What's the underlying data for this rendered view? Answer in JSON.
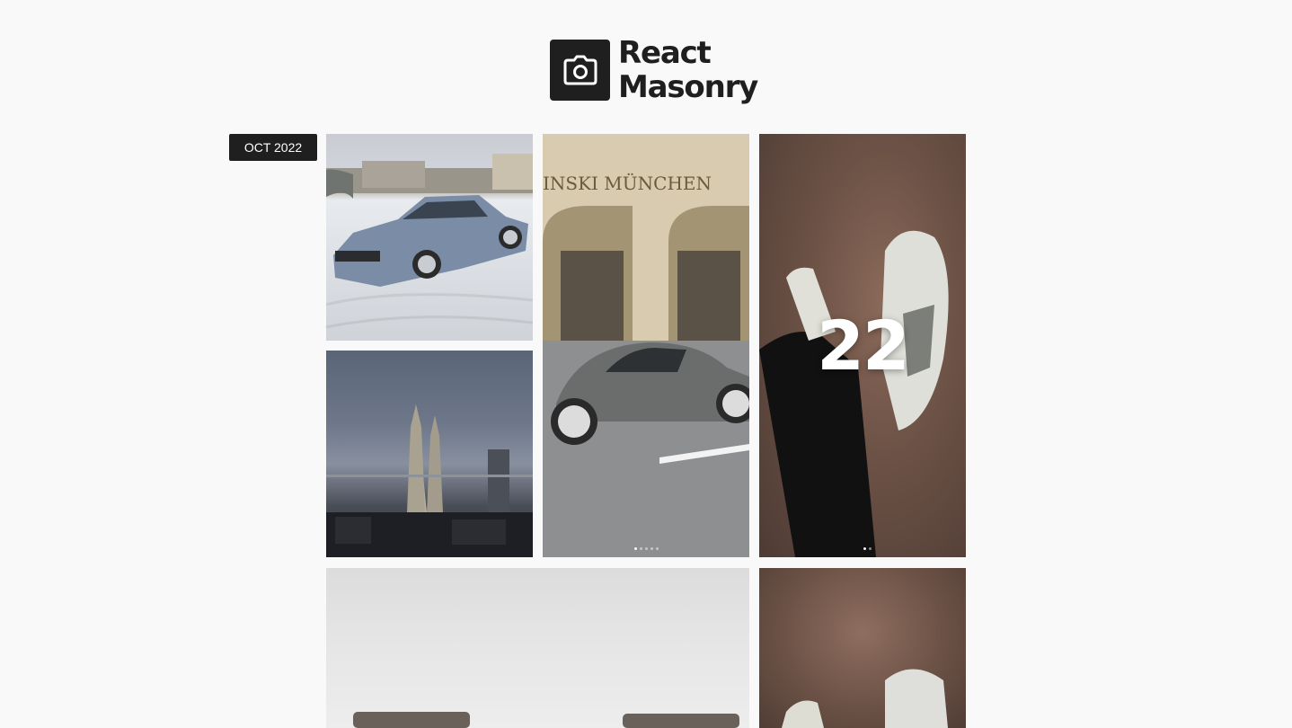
{
  "header": {
    "title_line1": "React",
    "title_line2": "Masonry",
    "logo_icon": "camera-icon"
  },
  "gallery": {
    "date_label": "OCT 2022",
    "tiles": [
      {
        "name": "bmw-coupe-snow-photo"
      },
      {
        "name": "porsche-hotel-munich-photo",
        "sign_text": "INSKI MÜNCHEN"
      },
      {
        "name": "sneakers-on-rug-photo",
        "count": "22"
      },
      {
        "name": "petronas-towers-skyline-photo"
      },
      {
        "name": "sofa-white-wall-photo"
      },
      {
        "name": "sneakers-rug-second-photo"
      }
    ]
  }
}
